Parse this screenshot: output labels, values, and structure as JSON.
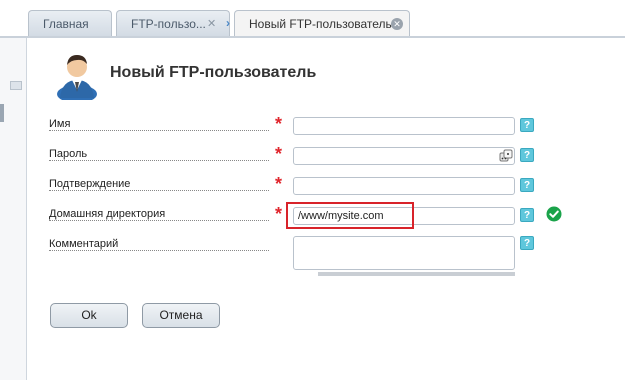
{
  "tabs": [
    {
      "label": "Главная"
    },
    {
      "label": "FTP-пользо..."
    },
    {
      "label": "Новый FTP-пользователь"
    }
  ],
  "page": {
    "title": "Новый FTP-пользователь"
  },
  "form": {
    "name": {
      "label": "Имя",
      "value": ""
    },
    "password": {
      "label": "Пароль",
      "value": ""
    },
    "confirm": {
      "label": "Подтверждение",
      "value": ""
    },
    "home_dir": {
      "label": "Домашняя директория",
      "value": "/www/mysite.com"
    },
    "comment": {
      "label": "Комментарий",
      "value": ""
    }
  },
  "required_mark": "*",
  "help_mark": "?",
  "buttons": {
    "ok": "Ok",
    "cancel": "Отмена"
  },
  "icons": {
    "tab_close": "close-icon",
    "tab_active_close": "close-circle-icon",
    "password_generate": "dice-icon",
    "valid": "check-circle-icon",
    "avatar": "user-avatar-icon"
  },
  "colors": {
    "required": "#e0262d",
    "help": "#5fc7dc",
    "valid": "#1aa34a",
    "highlight": "#d8232a"
  }
}
